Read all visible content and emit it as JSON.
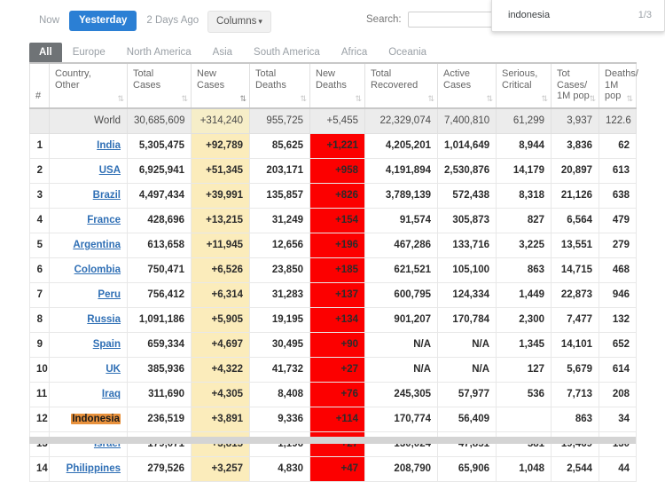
{
  "toolbar": {
    "day_tabs": [
      {
        "label": "Now",
        "active": false
      },
      {
        "label": "Yesterday",
        "active": true
      },
      {
        "label": "2 Days Ago",
        "active": false
      }
    ],
    "columns_label": "Columns",
    "columns_caret": "▾",
    "search_label": "Search:",
    "search_value": "",
    "search_placeholder": ""
  },
  "find_bar": {
    "term": "indonesia",
    "count": "1/3"
  },
  "continent_tabs": [
    {
      "label": "All",
      "active": true
    },
    {
      "label": "Europe",
      "active": false
    },
    {
      "label": "North America",
      "active": false
    },
    {
      "label": "Asia",
      "active": false
    },
    {
      "label": "South America",
      "active": false
    },
    {
      "label": "Africa",
      "active": false
    },
    {
      "label": "Oceania",
      "active": false
    }
  ],
  "table": {
    "headers": [
      {
        "l1": "#",
        "l2": "",
        "sortable": false
      },
      {
        "l1": "Country,",
        "l2": "Other",
        "sortable": true
      },
      {
        "l1": "Total",
        "l2": "Cases",
        "sortable": true
      },
      {
        "l1": "New",
        "l2": "Cases",
        "sortable": true,
        "sorted": true
      },
      {
        "l1": "Total",
        "l2": "Deaths",
        "sortable": true
      },
      {
        "l1": "New",
        "l2": "Deaths",
        "sortable": true
      },
      {
        "l1": "Total",
        "l2": "Recovered",
        "sortable": true
      },
      {
        "l1": "Active",
        "l2": "Cases",
        "sortable": true
      },
      {
        "l1": "Serious,",
        "l2": "Critical",
        "sortable": true
      },
      {
        "l1": "Tot Cases/",
        "l2": "1M pop",
        "sortable": true
      },
      {
        "l1": "Deaths/",
        "l2": "1M pop",
        "sortable": true
      }
    ],
    "world_row": {
      "rank": "",
      "country": "World",
      "total_cases": "30,685,609",
      "new_cases": "+314,240",
      "total_deaths": "955,725",
      "new_deaths": "+5,455",
      "total_recovered": "22,329,074",
      "active_cases": "7,400,810",
      "serious_critical": "61,299",
      "cases_per_1m": "3,937",
      "deaths_per_1m": "122.6"
    },
    "rows": [
      {
        "rank": "1",
        "country": "India",
        "total_cases": "5,305,475",
        "new_cases": "+92,789",
        "total_deaths": "85,625",
        "new_deaths": "+1,221",
        "total_recovered": "4,205,201",
        "active_cases": "1,014,649",
        "serious_critical": "8,944",
        "cases_per_1m": "3,836",
        "deaths_per_1m": "62",
        "highlight": false
      },
      {
        "rank": "2",
        "country": "USA",
        "total_cases": "6,925,941",
        "new_cases": "+51,345",
        "total_deaths": "203,171",
        "new_deaths": "+958",
        "total_recovered": "4,191,894",
        "active_cases": "2,530,876",
        "serious_critical": "14,179",
        "cases_per_1m": "20,897",
        "deaths_per_1m": "613",
        "highlight": false
      },
      {
        "rank": "3",
        "country": "Brazil",
        "total_cases": "4,497,434",
        "new_cases": "+39,991",
        "total_deaths": "135,857",
        "new_deaths": "+826",
        "total_recovered": "3,789,139",
        "active_cases": "572,438",
        "serious_critical": "8,318",
        "cases_per_1m": "21,126",
        "deaths_per_1m": "638",
        "highlight": false
      },
      {
        "rank": "4",
        "country": "France",
        "total_cases": "428,696",
        "new_cases": "+13,215",
        "total_deaths": "31,249",
        "new_deaths": "+154",
        "total_recovered": "91,574",
        "active_cases": "305,873",
        "serious_critical": "827",
        "cases_per_1m": "6,564",
        "deaths_per_1m": "479",
        "highlight": false
      },
      {
        "rank": "5",
        "country": "Argentina",
        "total_cases": "613,658",
        "new_cases": "+11,945",
        "total_deaths": "12,656",
        "new_deaths": "+196",
        "total_recovered": "467,286",
        "active_cases": "133,716",
        "serious_critical": "3,225",
        "cases_per_1m": "13,551",
        "deaths_per_1m": "279",
        "highlight": false
      },
      {
        "rank": "6",
        "country": "Colombia",
        "total_cases": "750,471",
        "new_cases": "+6,526",
        "total_deaths": "23,850",
        "new_deaths": "+185",
        "total_recovered": "621,521",
        "active_cases": "105,100",
        "serious_critical": "863",
        "cases_per_1m": "14,715",
        "deaths_per_1m": "468",
        "highlight": false
      },
      {
        "rank": "7",
        "country": "Peru",
        "total_cases": "756,412",
        "new_cases": "+6,314",
        "total_deaths": "31,283",
        "new_deaths": "+137",
        "total_recovered": "600,795",
        "active_cases": "124,334",
        "serious_critical": "1,449",
        "cases_per_1m": "22,873",
        "deaths_per_1m": "946",
        "highlight": false
      },
      {
        "rank": "8",
        "country": "Russia",
        "total_cases": "1,091,186",
        "new_cases": "+5,905",
        "total_deaths": "19,195",
        "new_deaths": "+134",
        "total_recovered": "901,207",
        "active_cases": "170,784",
        "serious_critical": "2,300",
        "cases_per_1m": "7,477",
        "deaths_per_1m": "132",
        "highlight": false
      },
      {
        "rank": "9",
        "country": "Spain",
        "total_cases": "659,334",
        "new_cases": "+4,697",
        "total_deaths": "30,495",
        "new_deaths": "+90",
        "total_recovered": "N/A",
        "active_cases": "N/A",
        "serious_critical": "1,345",
        "cases_per_1m": "14,101",
        "deaths_per_1m": "652",
        "highlight": false
      },
      {
        "rank": "10",
        "country": "UK",
        "total_cases": "385,936",
        "new_cases": "+4,322",
        "total_deaths": "41,732",
        "new_deaths": "+27",
        "total_recovered": "N/A",
        "active_cases": "N/A",
        "serious_critical": "127",
        "cases_per_1m": "5,679",
        "deaths_per_1m": "614",
        "highlight": false
      },
      {
        "rank": "11",
        "country": "Iraq",
        "total_cases": "311,690",
        "new_cases": "+4,305",
        "total_deaths": "8,408",
        "new_deaths": "+76",
        "total_recovered": "245,305",
        "active_cases": "57,977",
        "serious_critical": "536",
        "cases_per_1m": "7,713",
        "deaths_per_1m": "208",
        "highlight": false
      },
      {
        "rank": "12",
        "country": "Indonesia",
        "total_cases": "236,519",
        "new_cases": "+3,891",
        "total_deaths": "9,336",
        "new_deaths": "+114",
        "total_recovered": "170,774",
        "active_cases": "56,409",
        "serious_critical": "",
        "cases_per_1m": "863",
        "deaths_per_1m": "34",
        "highlight": true
      },
      {
        "rank": "13",
        "country": "Israel",
        "total_cases": "179,071",
        "new_cases": "+3,815",
        "total_deaths": "1,196",
        "new_deaths": "+27",
        "total_recovered": "130,024",
        "active_cases": "47,851",
        "serious_critical": "581",
        "cases_per_1m": "19,469",
        "deaths_per_1m": "130",
        "highlight": false
      },
      {
        "rank": "14",
        "country": "Philippines",
        "total_cases": "279,526",
        "new_cases": "+3,257",
        "total_deaths": "4,830",
        "new_deaths": "+47",
        "total_recovered": "208,790",
        "active_cases": "65,906",
        "serious_critical": "1,048",
        "cases_per_1m": "2,544",
        "deaths_per_1m": "44",
        "highlight": false
      }
    ]
  },
  "colors": {
    "active_tab_blue": "#2b7fd4",
    "active_continent_gray": "#6f7376",
    "new_cases_yellow": "#fbecbb",
    "new_deaths_red": "#fc0000",
    "find_highlight_orange": "#e8913c",
    "country_link_blue": "#2f6fb5"
  }
}
